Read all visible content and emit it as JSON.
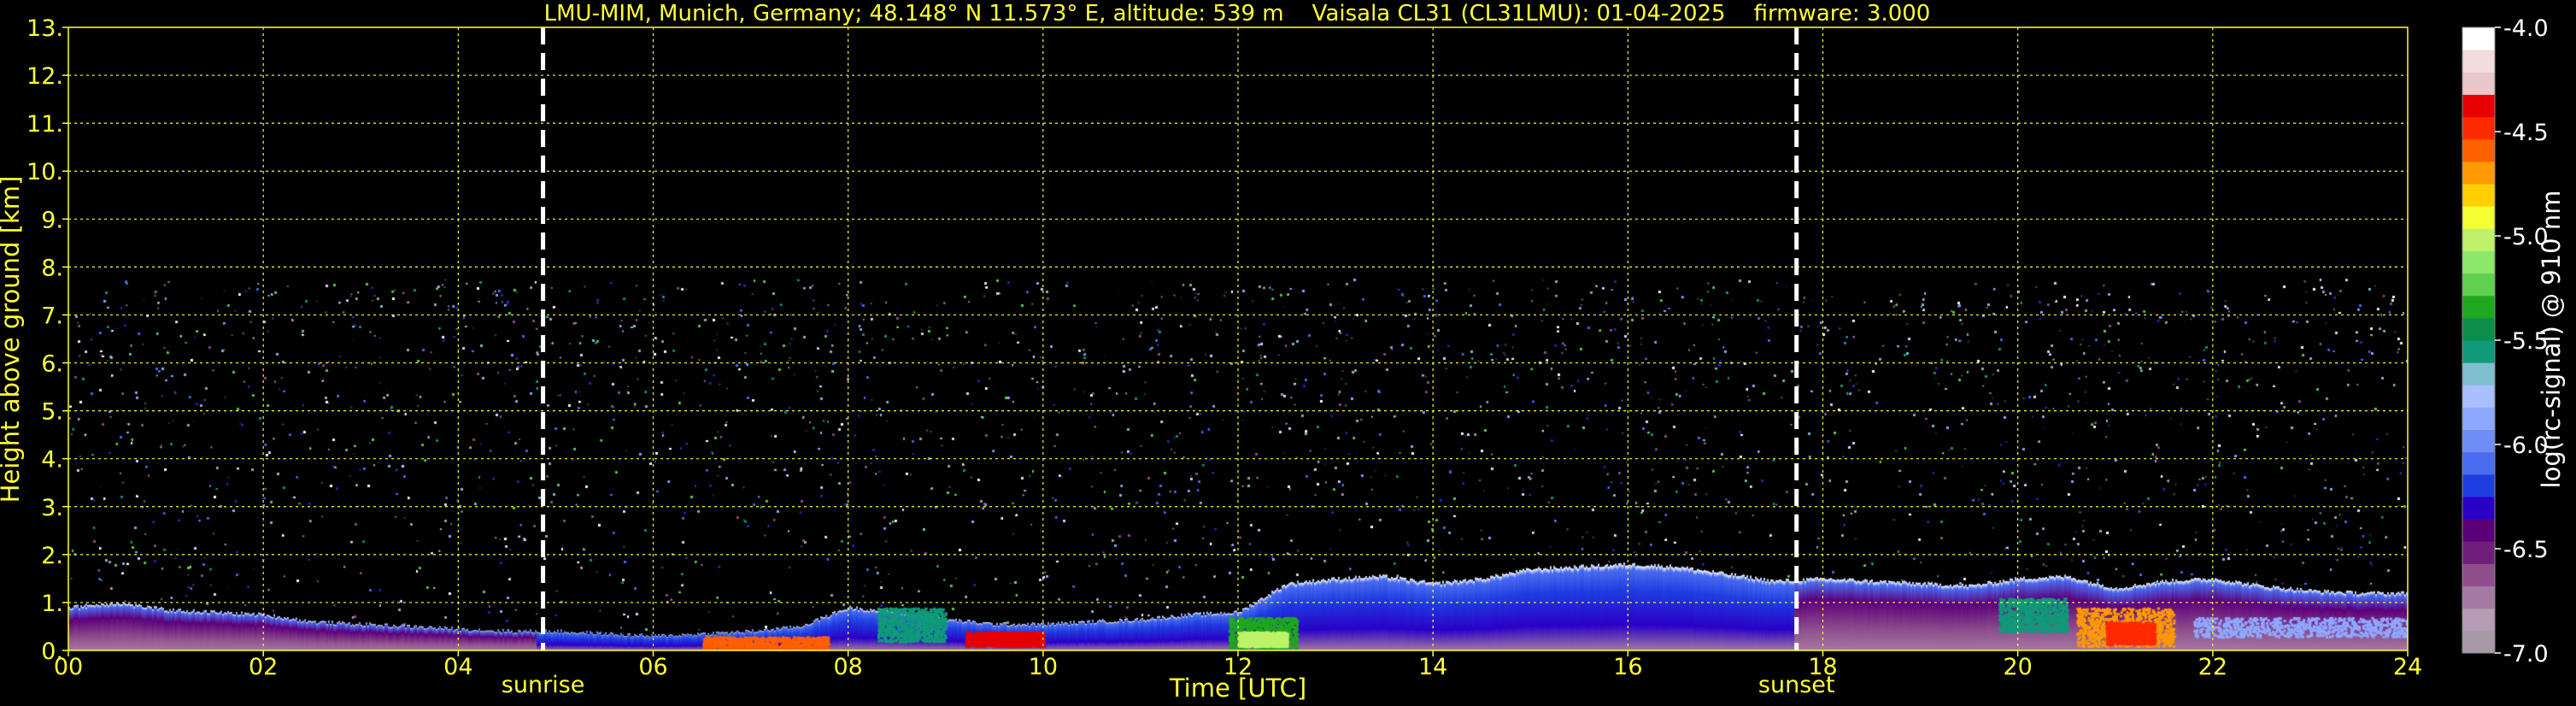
{
  "chart_data": {
    "type": "heatmap",
    "title": "LMU-MIM, Munich, Germany; 48.148° N 11.573° E, altitude: 539 m    Vaisala CL31 (CL31LMU): 01-04-2025    firmware: 3.000",
    "xlabel": "Time [UTC]",
    "ylabel": "Height above ground [km]",
    "xlim": [
      0,
      24
    ],
    "ylim": [
      0,
      13
    ],
    "x_ticks": [
      "00",
      "02",
      "04",
      "06",
      "08",
      "10",
      "12",
      "14",
      "16",
      "18",
      "20",
      "22",
      "24"
    ],
    "y_ticks": [
      "0.",
      "1.",
      "2.",
      "3.",
      "4.",
      "5.",
      "6.",
      "7.",
      "8.",
      "9.",
      "10.",
      "11.",
      "12.",
      "13."
    ],
    "grid": true,
    "events": [
      {
        "label": "sunrise",
        "time": 4.87
      },
      {
        "label": "sunset",
        "time": 17.73
      }
    ],
    "signal_top_km": 7.75,
    "boundary_layer_top_km": {
      "time": [
        0,
        0.5,
        1,
        1.5,
        2,
        2.5,
        3,
        3.5,
        4,
        4.5,
        5,
        5.5,
        6,
        6.5,
        7,
        7.5,
        8,
        8.5,
        9,
        9.5,
        10,
        10.5,
        11,
        11.5,
        12,
        12.5,
        13,
        13.5,
        14,
        14.5,
        15,
        15.5,
        16,
        16.5,
        17,
        17.5,
        18,
        18.5,
        19,
        19.5,
        20,
        20.5,
        21,
        21.5,
        22,
        22.5,
        23,
        23.5
      ],
      "height": [
        0.9,
        1.0,
        0.85,
        0.8,
        0.75,
        0.6,
        0.55,
        0.5,
        0.45,
        0.4,
        0.4,
        0.35,
        0.3,
        0.35,
        0.4,
        0.5,
        0.9,
        0.8,
        0.65,
        0.55,
        0.55,
        0.6,
        0.65,
        0.75,
        0.8,
        1.4,
        1.5,
        1.55,
        1.4,
        1.5,
        1.7,
        1.75,
        1.8,
        1.75,
        1.6,
        1.45,
        1.5,
        1.45,
        1.4,
        1.35,
        1.5,
        1.55,
        1.3,
        1.45,
        1.5,
        1.35,
        1.25,
        1.2
      ]
    },
    "colorbar": {
      "label": "log(rc-signal) @ 910 nm",
      "range": [
        -7.0,
        -4.0
      ],
      "ticks": [
        "-4.0",
        "-4.5",
        "-5.0",
        "-5.5",
        "-6.0",
        "-6.5",
        "-7.0"
      ],
      "colors": [
        "#a899a8",
        "#b79cb5",
        "#a57aa2",
        "#8e4e8c",
        "#6f1e7a",
        "#5c007a",
        "#2a00c8",
        "#1f3ee0",
        "#4a6cf0",
        "#6f8ef5",
        "#8fa8ff",
        "#a9bfff",
        "#7fbfd0",
        "#109a7a",
        "#0b8e4a",
        "#1fa81f",
        "#5fd050",
        "#8de86a",
        "#bff26a",
        "#f5ff33",
        "#ffd000",
        "#ff9a00",
        "#ff6000",
        "#ff2a00",
        "#e60000",
        "#e8c8c8",
        "#f2dcdc",
        "#ffffff"
      ]
    }
  }
}
